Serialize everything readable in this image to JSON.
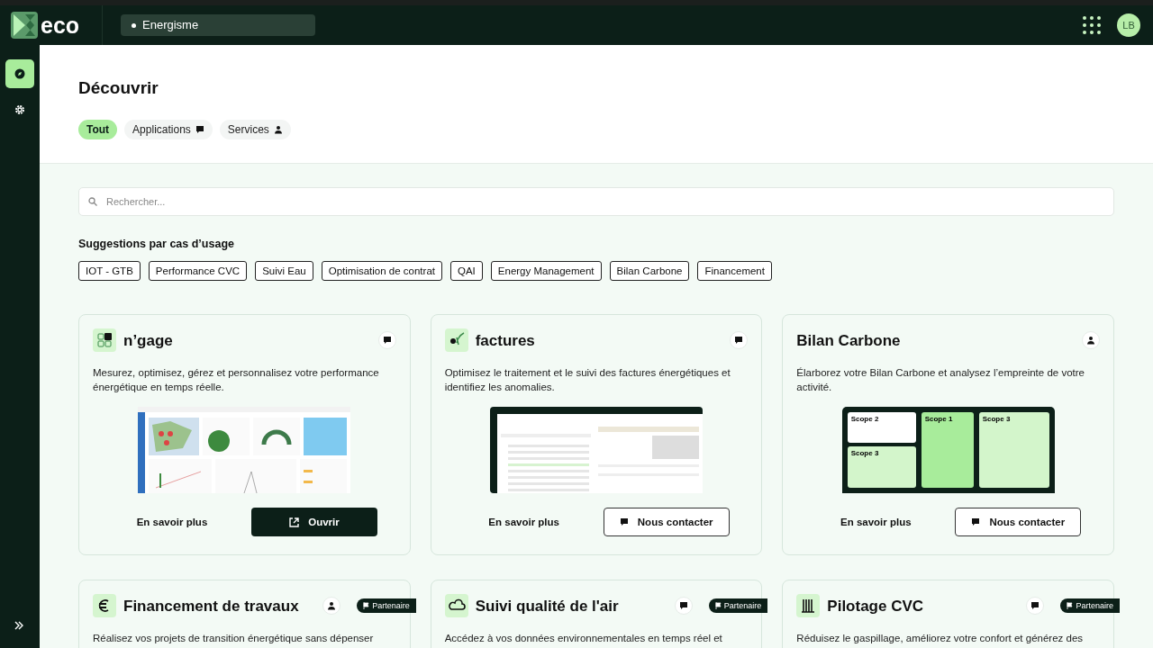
{
  "topbar": {
    "brand": "eco",
    "workspace": "Energisme",
    "avatar": "LB"
  },
  "sidebar": {
    "items": [
      {
        "kind": "discover",
        "selected": true
      },
      {
        "kind": "settings",
        "selected": false
      }
    ]
  },
  "page": {
    "title": "Découvrir"
  },
  "filters": [
    {
      "label": "Tout",
      "kind": "all",
      "selected": true
    },
    {
      "label": "Applications",
      "kind": "chat",
      "selected": false
    },
    {
      "label": "Services",
      "kind": "person",
      "selected": false
    }
  ],
  "search": {
    "placeholder": "Rechercher..."
  },
  "suggestions": {
    "title": "Suggestions par cas d’usage",
    "tags": [
      "IOT - GTB",
      "Performance CVC",
      "Suivi Eau",
      "Optimisation de contrat",
      "QAI",
      "Energy Management",
      "Bilan Carbone",
      "Financement"
    ]
  },
  "cards": [
    {
      "title": "n’gage",
      "logo": {
        "kind": "squares"
      },
      "kind": "chat",
      "partner": false,
      "description": "Mesurez, optimisez, gérez et personnalisez votre performance énergétique en temps réelle.",
      "preview": {
        "kind": "dashboard"
      },
      "link": "En savoir plus",
      "action": {
        "kind": "open",
        "label": "Ouvrir"
      }
    },
    {
      "title": "factures",
      "logo": {
        "kind": "leaf"
      },
      "kind": "chat",
      "partner": false,
      "description": "Optimisez le traitement et le suivi des factures énergétiques et identifiez les anomalies.",
      "preview": {
        "kind": "invoices"
      },
      "link": "En savoir plus",
      "action": {
        "kind": "contact",
        "label": "Nous contacter"
      }
    },
    {
      "title": "Bilan Carbone",
      "kind": "person",
      "partner": false,
      "description": "Élarborez votre Bilan Carbone et analysez l’empreinte de votre activité.",
      "preview": {
        "kind": "scopes",
        "labels": [
          "Scope 2",
          "Scope 3",
          "Scope 1",
          "Scope 3"
        ]
      },
      "link": "En savoir plus",
      "action": {
        "kind": "contact",
        "label": "Nous contacter"
      }
    },
    {
      "title": "Financement de travaux",
      "logo": {
        "kind": "euro"
      },
      "kind": "person",
      "partner": true,
      "partner_label": "Partenaire",
      "description": "Réalisez vos projets de transition énergétique sans dépenser"
    },
    {
      "title": "Suivi qualité de l'air",
      "logo": {
        "kind": "cloud"
      },
      "kind": "chat",
      "partner": true,
      "partner_label": "Partenaire",
      "description": "Accédez à vos données environnementales en temps réel et"
    },
    {
      "title": "Pilotage CVC",
      "logo": {
        "kind": "radiator"
      },
      "kind": "chat",
      "partner": true,
      "partner_label": "Partenaire",
      "description": "Réduisez le gaspillage, améliorez votre confort et générez des"
    }
  ]
}
